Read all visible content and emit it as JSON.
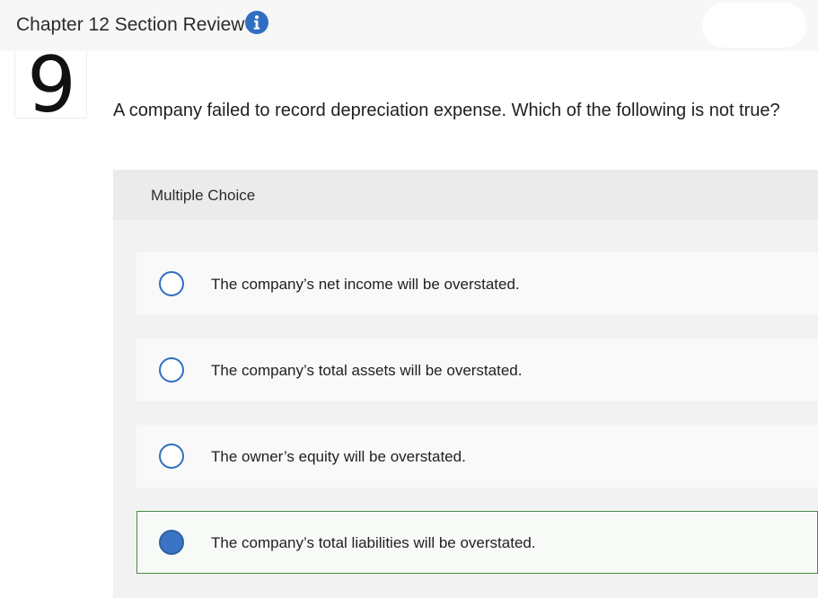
{
  "header": {
    "title": "Chapter 12 Section Review",
    "info_icon": "info-icon"
  },
  "question": {
    "number": "9",
    "text": "A company failed to record depreciation expense. Which of the following is not true?"
  },
  "multiple_choice": {
    "label": "Multiple Choice",
    "options": [
      {
        "text": "The company’s net income will be overstated.",
        "selected": false
      },
      {
        "text": "The company’s total assets will be overstated.",
        "selected": false
      },
      {
        "text": "The owner’s equity will be overstated.",
        "selected": false
      },
      {
        "text": "The company’s total liabilities will be overstated.",
        "selected": true
      }
    ]
  },
  "colors": {
    "accent": "#2f6fc1",
    "selected_border": "#4a8a4a"
  }
}
